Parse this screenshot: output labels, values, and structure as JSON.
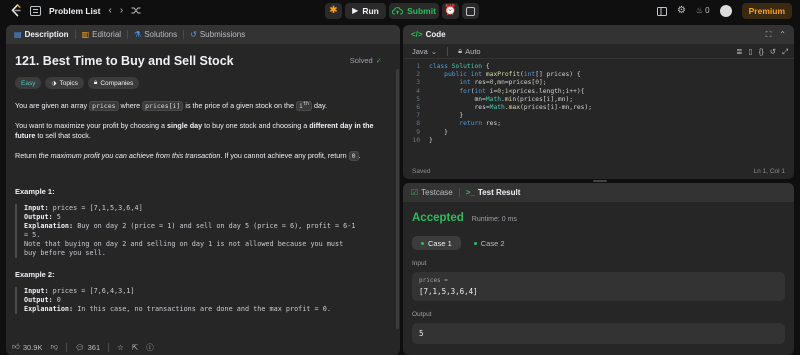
{
  "topbar": {
    "title": "Problem List",
    "run_label": "Run",
    "submit_label": "Submit",
    "streak_count": "0",
    "premium_label": "Premium",
    "colors": {
      "accent": "#ffa116",
      "submit": "#2cbb5d"
    }
  },
  "description_panel": {
    "tabs": [
      {
        "label": "Description",
        "icon": "description-icon"
      },
      {
        "label": "Editorial",
        "icon": "editorial-icon"
      },
      {
        "label": "Solutions",
        "icon": "solutions-icon"
      },
      {
        "label": "Submissions",
        "icon": "submissions-icon"
      }
    ],
    "title": "121. Best Time to Buy and Sell Stock",
    "solved_label": "Solved",
    "tags": {
      "difficulty": "Easy",
      "topics": "Topics",
      "companies": "Companies"
    },
    "p1": {
      "a": "You are given an array ",
      "code1": "prices",
      "b": " where ",
      "code2": "prices[i]",
      "c": " is the price of a given stock on the ",
      "sup_i": "i",
      "sup_th": "th",
      "d": " day."
    },
    "p2": {
      "a": "You want to maximize your profit by choosing a ",
      "b1": "single day",
      "c": " to buy one stock and choosing a ",
      "b2": "different day in the future",
      "d": " to sell that stock."
    },
    "p3": {
      "a": "Return ",
      "i1": "the maximum profit you can achieve from this transaction",
      "b": ". If you cannot achieve any profit, return ",
      "code": "0",
      "c": "."
    },
    "examples": [
      {
        "title": "Example 1:",
        "input_label": "Input:",
        "input": " prices = [7,1,5,3,6,4]",
        "output_label": "Output:",
        "output": " 5",
        "expl_label": "Explanation:",
        "expl": " Buy on day 2 (price = 1) and sell on day 5 (price = 6), profit = 6-1",
        "expl2": "= 5.",
        "note1": "Note that buying on day 2 and selling on day 1 is not allowed because you must",
        "note2": "buy before you sell."
      },
      {
        "title": "Example 2:",
        "input_label": "Input:",
        "input": " prices = [7,6,4,3,1]",
        "output_label": "Output:",
        "output": " 0",
        "expl_label": "Explanation:",
        "expl": " In this case, no transactions are done and the max profit = 0."
      }
    ],
    "footer": {
      "likes": "30.9K",
      "comments": "361"
    }
  },
  "code_panel": {
    "tab_label": "Code",
    "language": "Java",
    "autocomplete": "Auto",
    "lines": [
      [
        "1",
        "class Solution {"
      ],
      [
        "2",
        "    public int maxProfit(int[] prices) {"
      ],
      [
        "3",
        "        int res=0,mn=prices[0];"
      ],
      [
        "4",
        "        for(int i=0;i<prices.length;i++){"
      ],
      [
        "5",
        "            mn=Math.min(prices[i],mn);"
      ],
      [
        "6",
        "            res=Math.max(prices[i]-mn,res);"
      ],
      [
        "7",
        "        }"
      ],
      [
        "8",
        "        return res;"
      ],
      [
        "9",
        "    }"
      ],
      [
        "10",
        "}"
      ]
    ],
    "status": "Saved",
    "cursor": "Ln 1, Col 1"
  },
  "result_panel": {
    "tabs": [
      {
        "label": "Testcase"
      },
      {
        "label": "Test Result"
      }
    ],
    "verdict": "Accepted",
    "runtime": "Runtime: 0 ms",
    "cases": [
      "Case 1",
      "Case 2"
    ],
    "input_label": "Input",
    "input_var": "prices =",
    "input_value": "[7,1,5,3,6,4]",
    "output_label": "Output",
    "output_value": "5"
  }
}
